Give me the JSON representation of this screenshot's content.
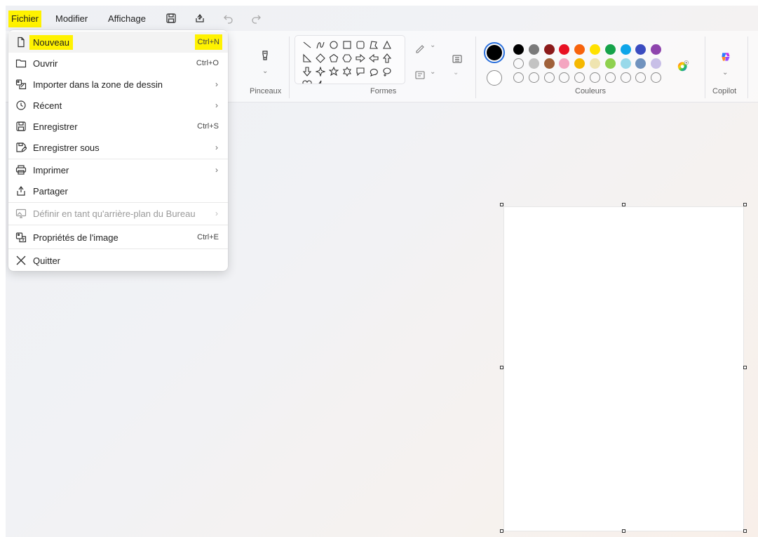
{
  "menubar": {
    "fichier": "Fichier",
    "modifier": "Modifier",
    "affichage": "Affichage",
    "icons": [
      "save-icon",
      "share-icon",
      "undo-icon",
      "redo-icon"
    ]
  },
  "ribbon": {
    "pinceaux": "Pinceaux",
    "formes": "Formes",
    "couleurs": "Couleurs",
    "copilot": "Copilot",
    "colors_row1": [
      "#000000",
      "#7a7a7a",
      "#8b1a1a",
      "#e81123",
      "#f7630c",
      "#ffe100",
      "#16a34a",
      "#0ea5e9",
      "#3b4cc0",
      "#8e44ad"
    ],
    "colors_row2": [
      "",
      "#c3c3c3",
      "#a0613a",
      "#f4a6c1",
      "#f5b800",
      "#efe4b0",
      "#8fd14f",
      "#99d9ea",
      "#7092be",
      "#c8bfe7"
    ],
    "primary_color": "#000000",
    "secondary_color": "#ffffff"
  },
  "file_menu": {
    "nouveau": {
      "label": "Nouveau",
      "shortcut": "Ctrl+N"
    },
    "ouvrir": {
      "label": "Ouvrir",
      "shortcut": "Ctrl+O"
    },
    "importer": {
      "label": "Importer dans la zone de dessin"
    },
    "recent": {
      "label": "Récent"
    },
    "enregistrer": {
      "label": "Enregistrer",
      "shortcut": "Ctrl+S"
    },
    "enregistrer_sous": {
      "label": "Enregistrer sous"
    },
    "imprimer": {
      "label": "Imprimer"
    },
    "partager": {
      "label": "Partager"
    },
    "definir": {
      "label": "Définir en tant qu'arrière-plan du Bureau"
    },
    "proprietes": {
      "label": "Propriétés de l'image",
      "shortcut": "Ctrl+E"
    },
    "quitter": {
      "label": "Quitter"
    }
  }
}
